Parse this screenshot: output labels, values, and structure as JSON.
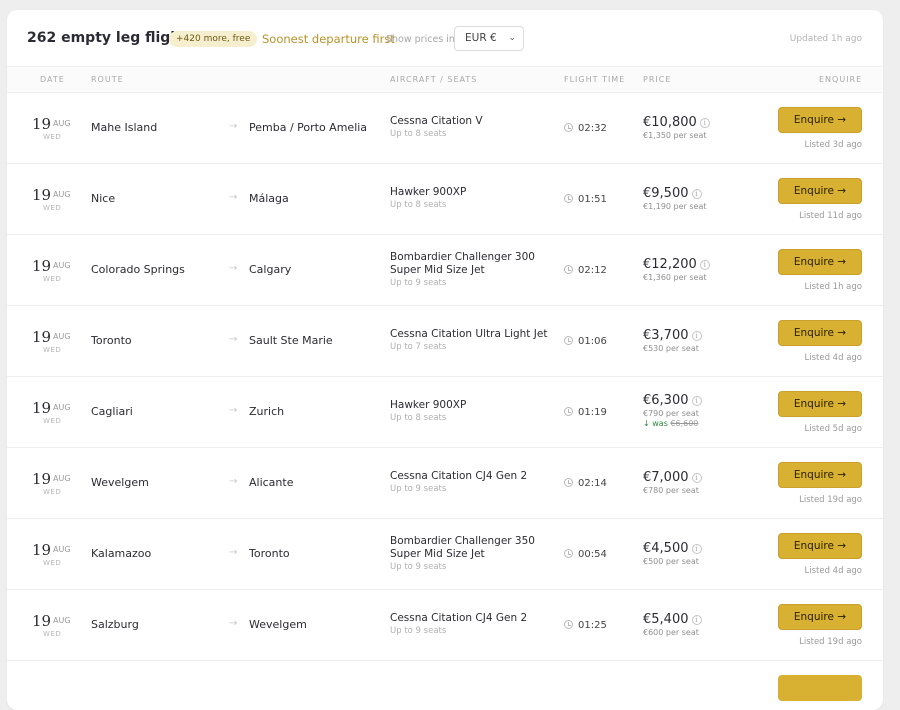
{
  "header": {
    "count_label": "262 empty leg flights",
    "more_badge": "+420 more, free",
    "sort_label": "Soonest departure first",
    "prices_label": "Show prices in",
    "currency": "EUR €",
    "updated": "Updated 1h ago"
  },
  "columns": {
    "date": "DATE",
    "route": "ROUTE",
    "aircraft": "AIRCRAFT / SEATS",
    "flight_time": "FLIGHT TIME",
    "price": "PRICE",
    "enquire": "ENQUIRE"
  },
  "icons": {
    "arrow": "→",
    "info": "i",
    "chevron": "⌄"
  },
  "rows": [
    {
      "day": "19",
      "month": "AUG",
      "weekday": "WED",
      "origin": "Mahe Island",
      "dest": "Pemba / Porto Amelia",
      "aircraft": "Cessna Citation V",
      "seats": "Up to 8 seats",
      "time": "02:32",
      "price": "€10,800",
      "per_seat": "€1,350 per seat",
      "was": "",
      "was_price": "",
      "button": "Enquire →",
      "listed": "Listed 3d ago"
    },
    {
      "day": "19",
      "month": "AUG",
      "weekday": "WED",
      "origin": "Nice",
      "dest": "Málaga",
      "aircraft": "Hawker 900XP",
      "seats": "Up to 8 seats",
      "time": "01:51",
      "price": "€9,500",
      "per_seat": "€1,190 per seat",
      "was": "",
      "was_price": "",
      "button": "Enquire →",
      "listed": "Listed 11d ago"
    },
    {
      "day": "19",
      "month": "AUG",
      "weekday": "WED",
      "origin": "Colorado Springs",
      "dest": "Calgary",
      "aircraft": "Bombardier Challenger 300 Super Mid Size Jet",
      "seats": "Up to 9 seats",
      "time": "02:12",
      "price": "€12,200",
      "per_seat": "€1,360 per seat",
      "was": "",
      "was_price": "",
      "button": "Enquire →",
      "listed": "Listed 1h ago"
    },
    {
      "day": "19",
      "month": "AUG",
      "weekday": "WED",
      "origin": "Toronto",
      "dest": "Sault Ste Marie",
      "aircraft": "Cessna Citation Ultra Light Jet",
      "seats": "Up to 7 seats",
      "time": "01:06",
      "price": "€3,700",
      "per_seat": "€530 per seat",
      "was": "",
      "was_price": "",
      "button": "Enquire →",
      "listed": "Listed 4d ago"
    },
    {
      "day": "19",
      "month": "AUG",
      "weekday": "WED",
      "origin": "Cagliari",
      "dest": "Zurich",
      "aircraft": "Hawker 900XP",
      "seats": "Up to 8 seats",
      "time": "01:19",
      "price": "€6,300",
      "per_seat": "€790 per seat",
      "was": "↓ was",
      "was_price": "€6,600",
      "button": "Enquire →",
      "listed": "Listed 5d ago"
    },
    {
      "day": "19",
      "month": "AUG",
      "weekday": "WED",
      "origin": "Wevelgem",
      "dest": "Alicante",
      "aircraft": "Cessna Citation CJ4 Gen 2",
      "seats": "Up to 9 seats",
      "time": "02:14",
      "price": "€7,000",
      "per_seat": "€780 per seat",
      "was": "",
      "was_price": "",
      "button": "Enquire →",
      "listed": "Listed 19d ago"
    },
    {
      "day": "19",
      "month": "AUG",
      "weekday": "WED",
      "origin": "Kalamazoo",
      "dest": "Toronto",
      "aircraft": "Bombardier Challenger 350 Super Mid Size Jet",
      "seats": "Up to 9 seats",
      "time": "00:54",
      "price": "€4,500",
      "per_seat": "€500 per seat",
      "was": "",
      "was_price": "",
      "button": "Enquire →",
      "listed": "Listed 4d ago"
    },
    {
      "day": "19",
      "month": "AUG",
      "weekday": "WED",
      "origin": "Salzburg",
      "dest": "Wevelgem",
      "aircraft": "Cessna Citation CJ4 Gen 2",
      "seats": "Up to 9 seats",
      "time": "01:25",
      "price": "€5,400",
      "per_seat": "€600 per seat",
      "was": "",
      "was_price": "",
      "button": "Enquire →",
      "listed": "Listed 19d ago"
    }
  ],
  "colors": {
    "accent": "#d8b032",
    "sort": "#b8922a",
    "badge_bg": "#f6efcf",
    "discount": "#2f8a3a"
  }
}
